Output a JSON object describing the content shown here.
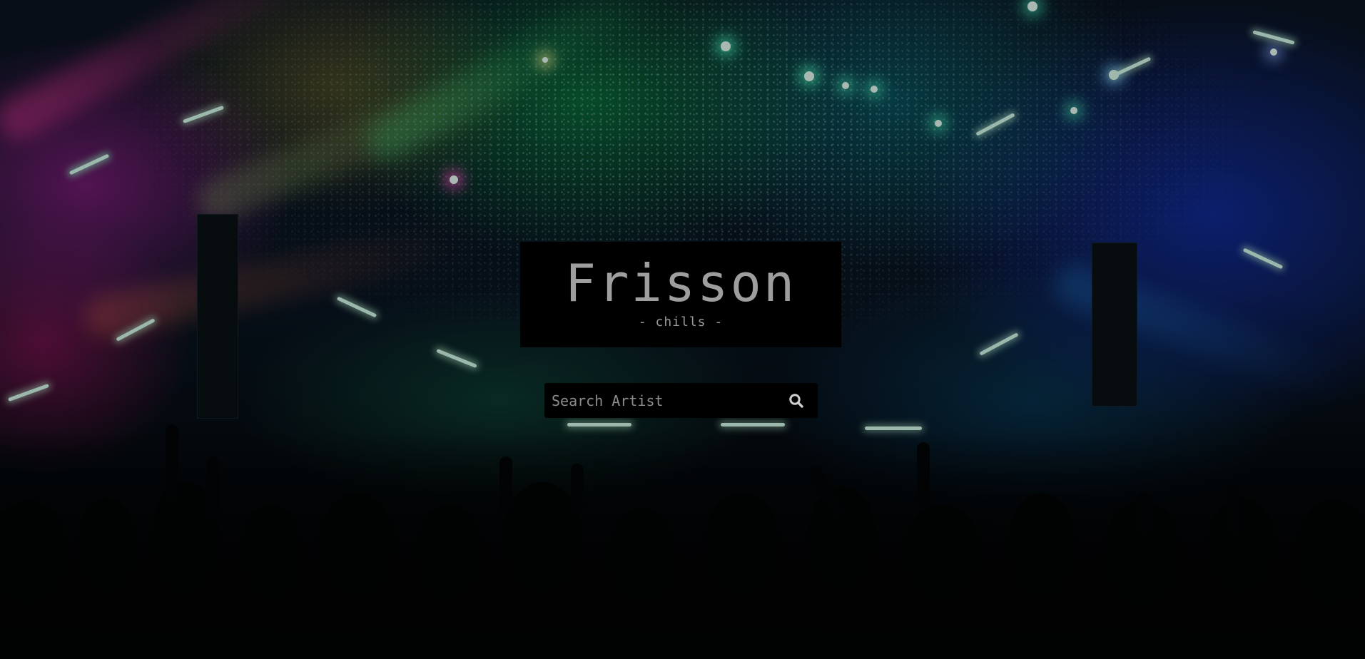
{
  "hero": {
    "title": "Frisson",
    "tagline": "- chills -"
  },
  "search": {
    "placeholder": "Search Artist",
    "value": "",
    "button_icon": "search-icon"
  },
  "colors": {
    "card_background": "#000000",
    "title_text": "#9e9e9e",
    "placeholder_text": "#8c8c8c"
  }
}
